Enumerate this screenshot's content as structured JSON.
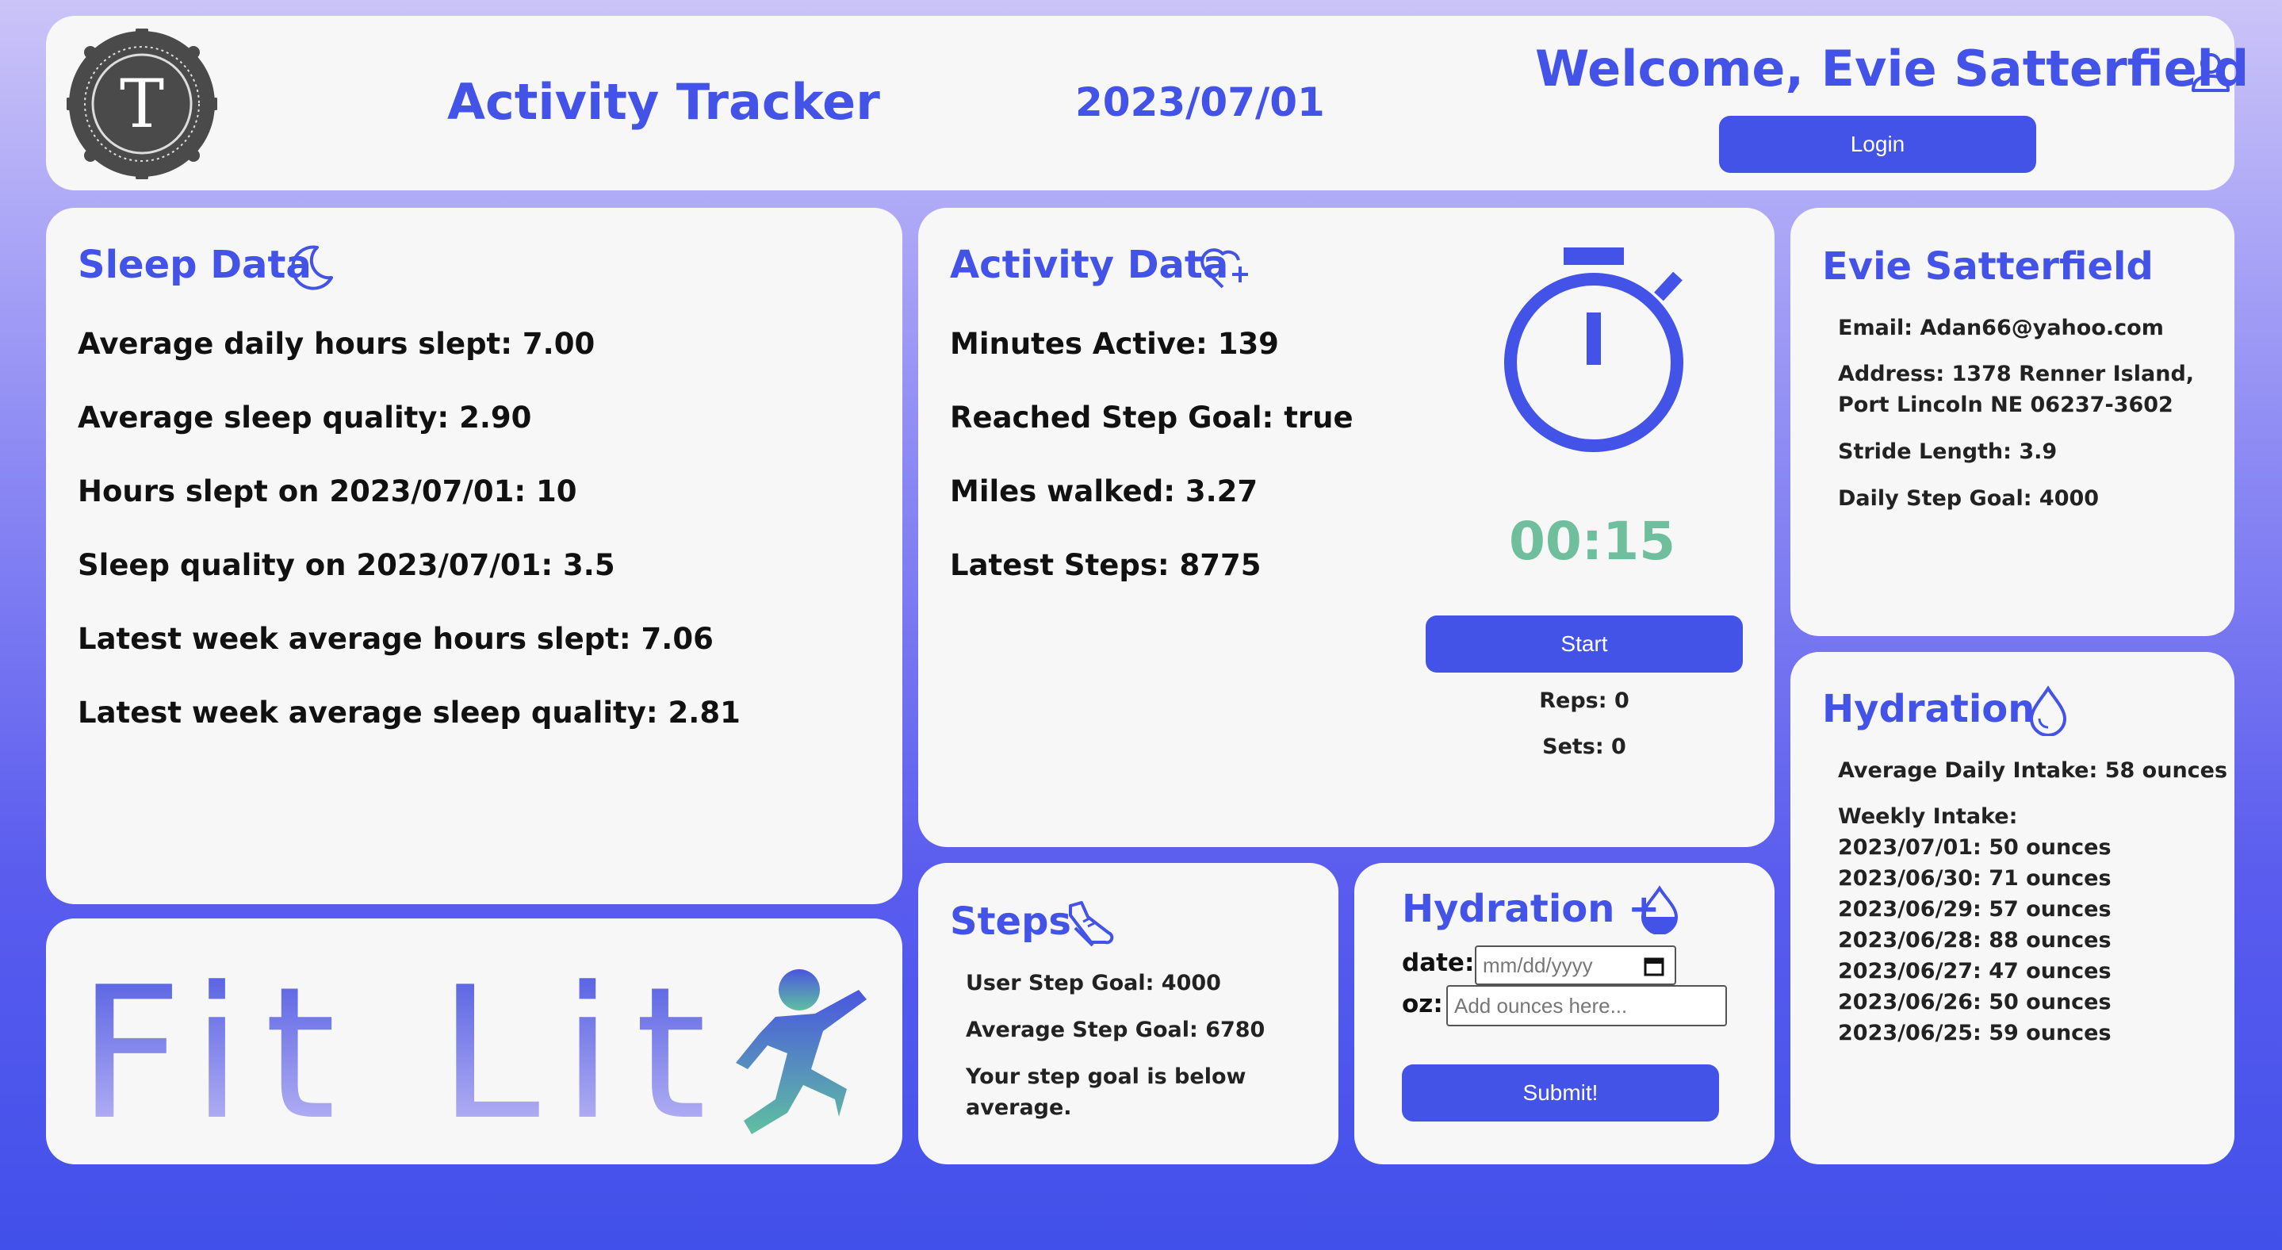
{
  "header": {
    "logo_letter": "T",
    "title": "Activity Tracker",
    "date": "2023/07/01",
    "welcome": "Welcome, Evie Satterfield",
    "login_label": "Login"
  },
  "sleep": {
    "title": "Sleep Data",
    "lines": [
      "Average daily hours slept: 7.00",
      "Average sleep quality: 2.90",
      "Hours slept on 2023/07/01: 10",
      "Sleep quality on 2023/07/01: 3.5",
      "Latest week average hours slept: 7.06",
      "Latest week average sleep quality: 2.81"
    ]
  },
  "brand": {
    "text": "Fit Lit"
  },
  "activity": {
    "title": "Activity Data",
    "lines": [
      "Minutes Active: 139",
      "Reached Step Goal: true",
      "Miles walked: 3.27",
      "Latest Steps: 8775"
    ],
    "timer": "00:15",
    "start_label": "Start",
    "reps": "Reps: 0",
    "sets": "Sets: 0"
  },
  "user": {
    "name": "Evie Satterfield",
    "email": "Email: Adan66@yahoo.com",
    "address_line1": "Address: 1378 Renner Island,",
    "address_line2": "Port Lincoln NE 06237-3602",
    "stride": "Stride Length: 3.9",
    "daily_goal": "Daily Step Goal: 4000"
  },
  "steps": {
    "title": "Steps",
    "user_goal": "User Step Goal: 4000",
    "avg_goal": "Average Step Goal: 6780",
    "note_line1": "Your step goal is below",
    "note_line2": "average."
  },
  "hydration_form": {
    "title": "Hydration +",
    "date_label": "date:",
    "date_placeholder": "mm/dd/yyyy",
    "oz_label": "oz:",
    "oz_placeholder": "Add ounces here...",
    "submit_label": "Submit!"
  },
  "hydration": {
    "title": "Hydration",
    "average": "Average Daily Intake: 58 ounces",
    "weekly_label": "Weekly Intake:",
    "weekly": [
      "2023/07/01: 50 ounces",
      "2023/06/30: 71 ounces",
      "2023/06/29: 57 ounces",
      "2023/06/28: 88 ounces",
      "2023/06/27: 47 ounces",
      "2023/06/26: 50 ounces",
      "2023/06/25: 59 ounces"
    ]
  },
  "colors": {
    "accent": "#4353e8",
    "timer": "#6fbf9f",
    "card": "#f7f7f7"
  }
}
